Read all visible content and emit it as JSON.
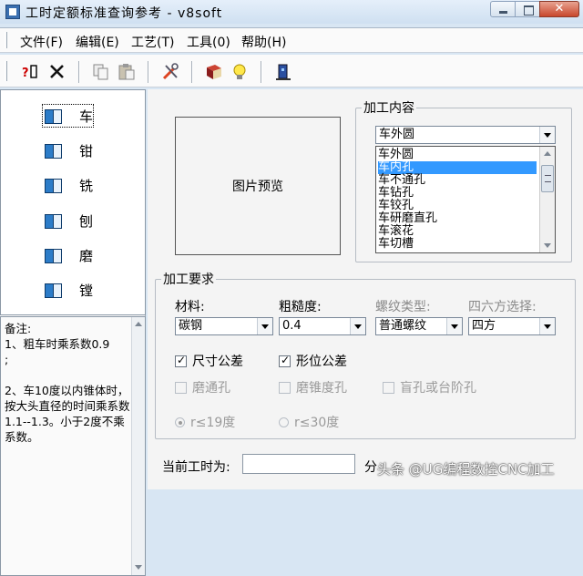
{
  "window": {
    "title": "工时定额标准查询参考 - v8soft",
    "icon": "app-icon",
    "controls": {
      "close_glyph": "✕"
    }
  },
  "menu": {
    "items": [
      {
        "id": "file",
        "label": "文件(F)"
      },
      {
        "id": "edit",
        "label": "编辑(E)"
      },
      {
        "id": "process",
        "label": "工艺(T)"
      },
      {
        "id": "tools",
        "label": "工具(0)"
      },
      {
        "id": "help",
        "label": "帮助(H)"
      }
    ]
  },
  "toolbar": {
    "buttons": [
      {
        "icon": "help-context-icon"
      },
      {
        "icon": "delete-icon"
      },
      {
        "icon": "copy-icon"
      },
      {
        "icon": "paste-icon"
      },
      {
        "icon": "tools-icon"
      },
      {
        "icon": "book-icon"
      },
      {
        "icon": "lightbulb-icon"
      },
      {
        "icon": "exit-icon"
      }
    ]
  },
  "process_list": {
    "selected": "车",
    "items": [
      {
        "label": "车",
        "icon": "book-icon"
      },
      {
        "label": "钳",
        "icon": "book-icon"
      },
      {
        "label": "铣",
        "icon": "book-icon"
      },
      {
        "label": "刨",
        "icon": "book-icon"
      },
      {
        "label": "磨",
        "icon": "book-icon"
      },
      {
        "label": "镗",
        "icon": "book-icon"
      }
    ]
  },
  "notes": {
    "title": "备注:",
    "text": "1、粗车时乘系数0.9\n;\n\n2、车10度以内锥体时，按大头直径的时间乘系数1.1--1.3。小于2度不乘系数。"
  },
  "preview": {
    "label": "图片预览"
  },
  "machining_content": {
    "legend": "加工内容",
    "selected": "车外圆",
    "options": [
      "车外圆",
      "车内孔",
      "车不通孔",
      "车钻孔",
      "车铰孔",
      "车研磨直孔",
      "车滚花",
      "车切槽"
    ],
    "highlighted": "车内孔"
  },
  "requirements": {
    "legend": "加工要求",
    "material": {
      "label": "材料:",
      "value": "碳钢"
    },
    "roughness": {
      "label": "粗糙度:",
      "value": "0.4"
    },
    "thread_type": {
      "label": "螺纹类型:",
      "value": "普通螺纹"
    },
    "hex_choice": {
      "label": "四六方选择:",
      "value": "四方"
    },
    "checkboxes": [
      {
        "label": "尺寸公差",
        "checked": true,
        "enabled": true
      },
      {
        "label": "形位公差",
        "checked": true,
        "enabled": true
      },
      {
        "label": "磨通孔",
        "checked": false,
        "enabled": false
      },
      {
        "label": "磨锥度孔",
        "checked": false,
        "enabled": false
      },
      {
        "label": "盲孔或台阶孔",
        "checked": false,
        "enabled": false
      }
    ],
    "radios": [
      {
        "label": "r≤19度",
        "selected": true
      },
      {
        "label": "r≤30度",
        "selected": false
      }
    ]
  },
  "current_time": {
    "label": "当前工时为:",
    "value": "",
    "unit": "分"
  },
  "watermark": "头条 @UG编程数控CNC加工"
}
